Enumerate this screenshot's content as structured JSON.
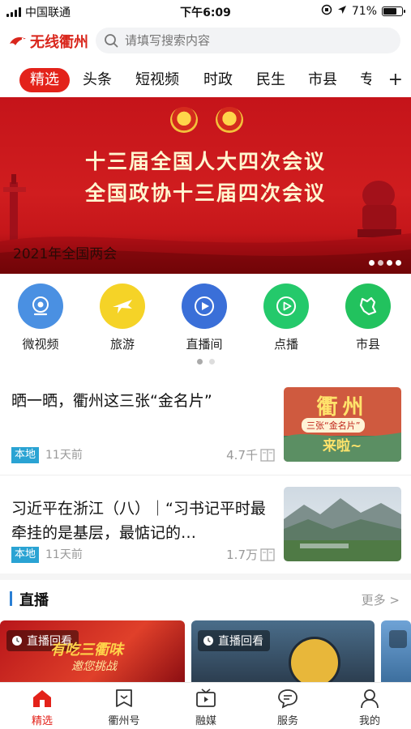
{
  "status_bar": {
    "carrier": "中国联通",
    "time": "下午6:09",
    "battery": "71%",
    "battery_level": 0.71
  },
  "header": {
    "logo_text": "无线衢州",
    "search_placeholder": "请填写搜索内容"
  },
  "tabs": [
    "精选",
    "头条",
    "短视频",
    "时政",
    "民生",
    "市县",
    "专"
  ],
  "tab_add_label": "+",
  "banner": {
    "line1": "十三届全国人大四次会议",
    "line2": "全国政协十三届四次会议",
    "caption": "2021年全国两会"
  },
  "quick_nav": [
    {
      "label": "微视频",
      "icon": "webcam-icon",
      "color": "#4a90e2"
    },
    {
      "label": "旅游",
      "icon": "plane-icon",
      "color": "#f5d327"
    },
    {
      "label": "直播间",
      "icon": "play-icon",
      "color": "#3a6fd8"
    },
    {
      "label": "点播",
      "icon": "play-circle-icon",
      "color": "#24c96b"
    },
    {
      "label": "市县",
      "icon": "map-icon",
      "color": "#22c25e"
    }
  ],
  "news": [
    {
      "title": "晒一晒，衢州这三张“金名片”",
      "tag": "本地",
      "time": "11天前",
      "count": "4.7千",
      "thumb_title": "衢州",
      "thumb_sub": "三张“金名片”",
      "thumb_tail": "来啦~"
    },
    {
      "title": "习近平在浙江（八）｜“习书记平时最牵挂的是基层，最惦记的…",
      "tag": "本地",
      "time": "11天前",
      "count": "1.7万"
    }
  ],
  "live": {
    "title": "直播",
    "more": "更多 >",
    "cards": [
      {
        "badge": "直播回看",
        "overlay": "有吃三衢味",
        "overlay2": "邀您挑战"
      },
      {
        "badge": "直播回看"
      }
    ]
  },
  "bottom_nav": [
    {
      "label": "精选",
      "icon": "home-icon",
      "active": true
    },
    {
      "label": "衢州号",
      "icon": "bookmark-icon",
      "active": false
    },
    {
      "label": "融媒",
      "icon": "tv-icon",
      "active": false
    },
    {
      "label": "服务",
      "icon": "chat-icon",
      "active": false
    },
    {
      "label": "我的",
      "icon": "user-icon",
      "active": false
    }
  ]
}
